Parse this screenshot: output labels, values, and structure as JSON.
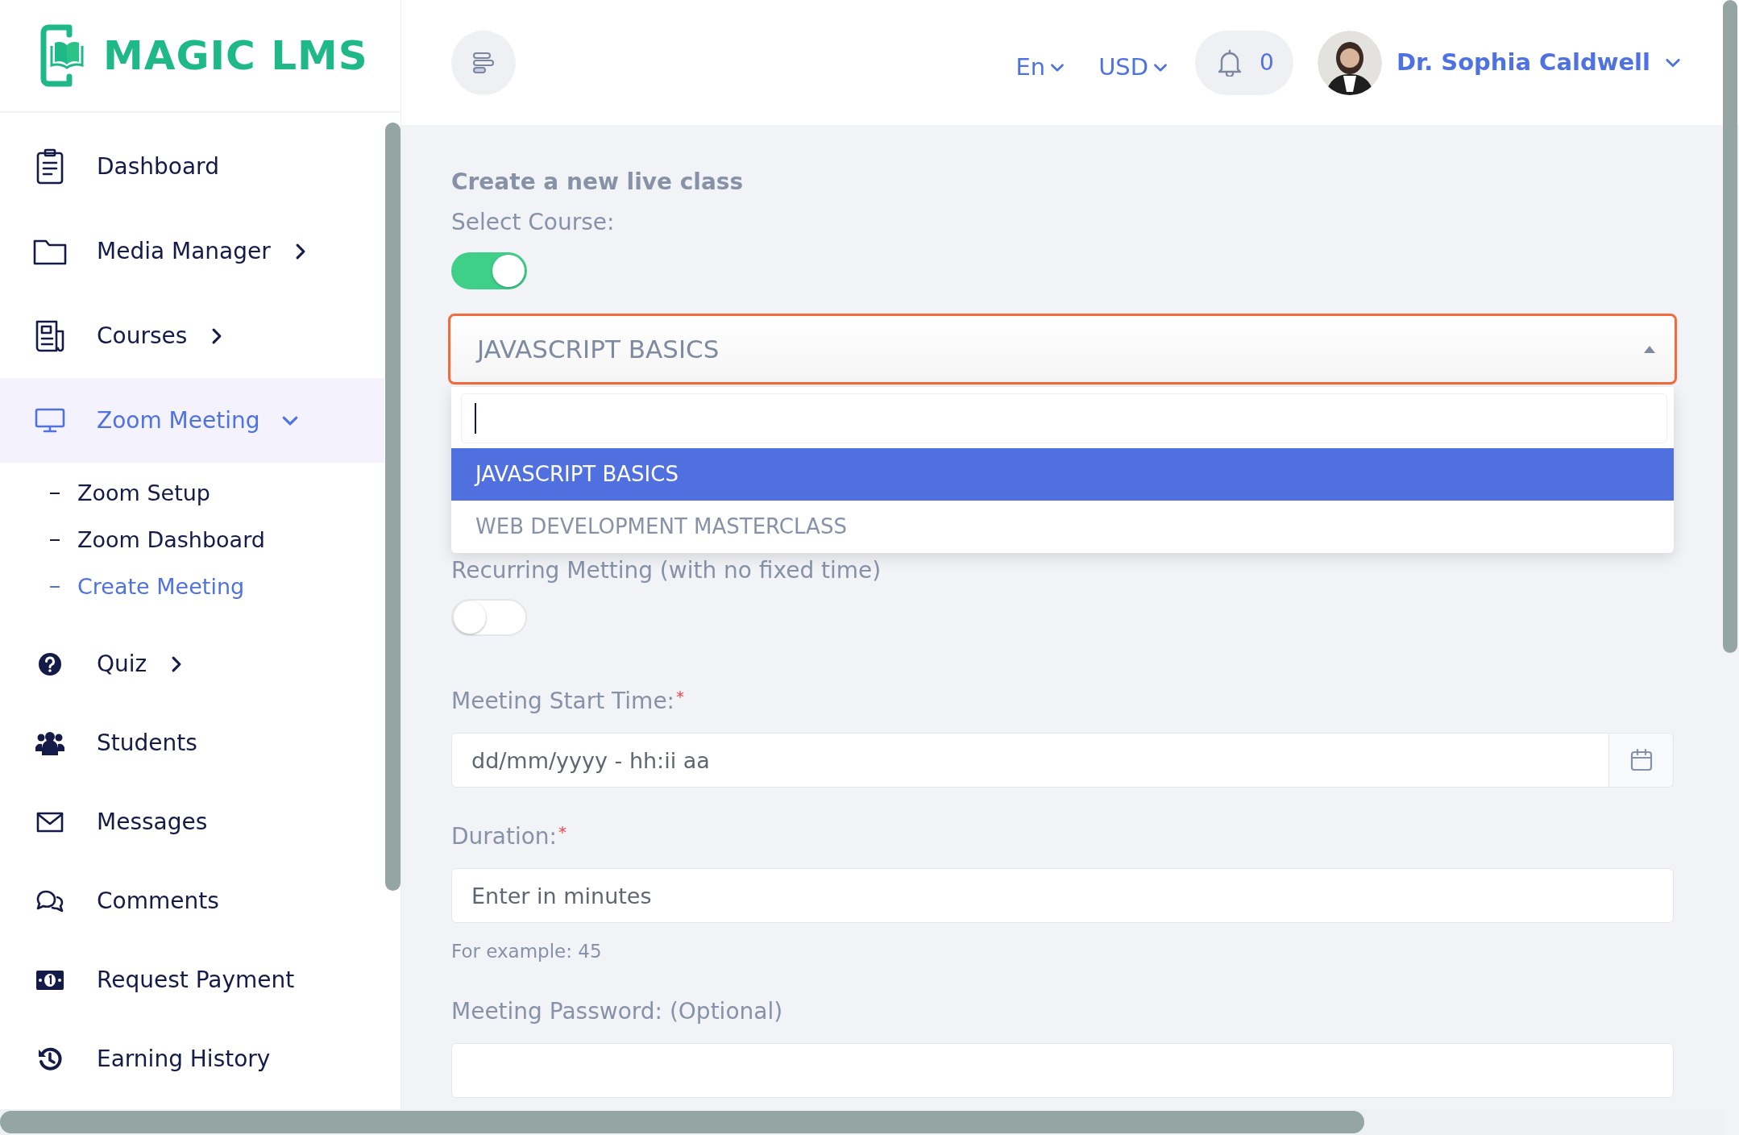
{
  "logo": {
    "text": "MAGIC LMS"
  },
  "header": {
    "language": "En",
    "currency": "USD",
    "notifications": "0",
    "user": "Dr. Sophia Caldwell"
  },
  "sidebar": {
    "items": [
      {
        "label": "Dashboard",
        "kind": "link",
        "selected": false
      },
      {
        "label": "Media Manager",
        "kind": "group",
        "expanded": false,
        "selected": false
      },
      {
        "label": "Courses",
        "kind": "group",
        "expanded": false,
        "selected": false
      },
      {
        "label": "Zoom Meeting",
        "kind": "group",
        "expanded": true,
        "selected": true,
        "children": [
          {
            "label": "Zoom Setup",
            "selected": false
          },
          {
            "label": "Zoom Dashboard",
            "selected": false
          },
          {
            "label": "Create Meeting",
            "selected": true
          }
        ]
      },
      {
        "label": "Quiz",
        "kind": "group",
        "expanded": false,
        "selected": false
      },
      {
        "label": "Students",
        "kind": "link",
        "selected": false
      },
      {
        "label": "Messages",
        "kind": "link",
        "selected": false
      },
      {
        "label": "Comments",
        "kind": "link",
        "selected": false
      },
      {
        "label": "Request Payment",
        "kind": "link",
        "selected": false
      },
      {
        "label": "Earning History",
        "kind": "link",
        "selected": false
      }
    ]
  },
  "form": {
    "title": "Create a new live class",
    "course": {
      "label": "Select Course:",
      "toggle_on": true,
      "value": "JAVASCRIPT BASICS",
      "open": true,
      "options": [
        {
          "label": "JAVASCRIPT BASICS",
          "selected": true
        },
        {
          "label": "WEB DEVELOPMENT MASTERCLASS",
          "selected": false
        }
      ]
    },
    "recurring": {
      "label": "Recurring Metting (with no fixed time)",
      "on": false
    },
    "start_time": {
      "label": "Meeting Start Time:",
      "required_mark": "*",
      "placeholder": "dd/mm/yyyy - hh:ii aa"
    },
    "duration": {
      "label": "Duration:",
      "required_mark": "*",
      "placeholder": "Enter in minutes",
      "help": "For example: 45"
    },
    "password": {
      "label": "Meeting Password: (Optional)"
    }
  }
}
